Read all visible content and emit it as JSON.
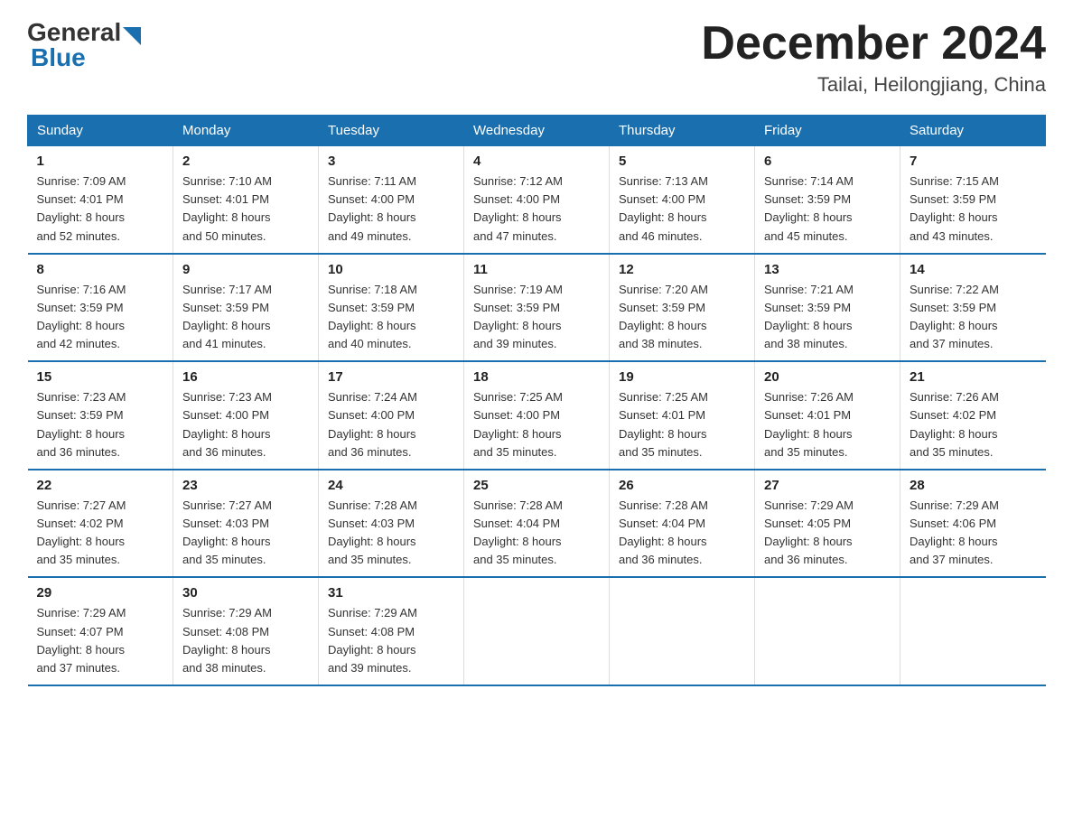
{
  "logo": {
    "general": "General",
    "blue": "Blue"
  },
  "title": {
    "month": "December 2024",
    "location": "Tailai, Heilongjiang, China"
  },
  "days_header": [
    "Sunday",
    "Monday",
    "Tuesday",
    "Wednesday",
    "Thursday",
    "Friday",
    "Saturday"
  ],
  "weeks": [
    [
      {
        "day": "1",
        "sunrise": "7:09 AM",
        "sunset": "4:01 PM",
        "daylight": "8 hours and 52 minutes."
      },
      {
        "day": "2",
        "sunrise": "7:10 AM",
        "sunset": "4:01 PM",
        "daylight": "8 hours and 50 minutes."
      },
      {
        "day": "3",
        "sunrise": "7:11 AM",
        "sunset": "4:00 PM",
        "daylight": "8 hours and 49 minutes."
      },
      {
        "day": "4",
        "sunrise": "7:12 AM",
        "sunset": "4:00 PM",
        "daylight": "8 hours and 47 minutes."
      },
      {
        "day": "5",
        "sunrise": "7:13 AM",
        "sunset": "4:00 PM",
        "daylight": "8 hours and 46 minutes."
      },
      {
        "day": "6",
        "sunrise": "7:14 AM",
        "sunset": "3:59 PM",
        "daylight": "8 hours and 45 minutes."
      },
      {
        "day": "7",
        "sunrise": "7:15 AM",
        "sunset": "3:59 PM",
        "daylight": "8 hours and 43 minutes."
      }
    ],
    [
      {
        "day": "8",
        "sunrise": "7:16 AM",
        "sunset": "3:59 PM",
        "daylight": "8 hours and 42 minutes."
      },
      {
        "day": "9",
        "sunrise": "7:17 AM",
        "sunset": "3:59 PM",
        "daylight": "8 hours and 41 minutes."
      },
      {
        "day": "10",
        "sunrise": "7:18 AM",
        "sunset": "3:59 PM",
        "daylight": "8 hours and 40 minutes."
      },
      {
        "day": "11",
        "sunrise": "7:19 AM",
        "sunset": "3:59 PM",
        "daylight": "8 hours and 39 minutes."
      },
      {
        "day": "12",
        "sunrise": "7:20 AM",
        "sunset": "3:59 PM",
        "daylight": "8 hours and 38 minutes."
      },
      {
        "day": "13",
        "sunrise": "7:21 AM",
        "sunset": "3:59 PM",
        "daylight": "8 hours and 38 minutes."
      },
      {
        "day": "14",
        "sunrise": "7:22 AM",
        "sunset": "3:59 PM",
        "daylight": "8 hours and 37 minutes."
      }
    ],
    [
      {
        "day": "15",
        "sunrise": "7:23 AM",
        "sunset": "3:59 PM",
        "daylight": "8 hours and 36 minutes."
      },
      {
        "day": "16",
        "sunrise": "7:23 AM",
        "sunset": "4:00 PM",
        "daylight": "8 hours and 36 minutes."
      },
      {
        "day": "17",
        "sunrise": "7:24 AM",
        "sunset": "4:00 PM",
        "daylight": "8 hours and 36 minutes."
      },
      {
        "day": "18",
        "sunrise": "7:25 AM",
        "sunset": "4:00 PM",
        "daylight": "8 hours and 35 minutes."
      },
      {
        "day": "19",
        "sunrise": "7:25 AM",
        "sunset": "4:01 PM",
        "daylight": "8 hours and 35 minutes."
      },
      {
        "day": "20",
        "sunrise": "7:26 AM",
        "sunset": "4:01 PM",
        "daylight": "8 hours and 35 minutes."
      },
      {
        "day": "21",
        "sunrise": "7:26 AM",
        "sunset": "4:02 PM",
        "daylight": "8 hours and 35 minutes."
      }
    ],
    [
      {
        "day": "22",
        "sunrise": "7:27 AM",
        "sunset": "4:02 PM",
        "daylight": "8 hours and 35 minutes."
      },
      {
        "day": "23",
        "sunrise": "7:27 AM",
        "sunset": "4:03 PM",
        "daylight": "8 hours and 35 minutes."
      },
      {
        "day": "24",
        "sunrise": "7:28 AM",
        "sunset": "4:03 PM",
        "daylight": "8 hours and 35 minutes."
      },
      {
        "day": "25",
        "sunrise": "7:28 AM",
        "sunset": "4:04 PM",
        "daylight": "8 hours and 35 minutes."
      },
      {
        "day": "26",
        "sunrise": "7:28 AM",
        "sunset": "4:04 PM",
        "daylight": "8 hours and 36 minutes."
      },
      {
        "day": "27",
        "sunrise": "7:29 AM",
        "sunset": "4:05 PM",
        "daylight": "8 hours and 36 minutes."
      },
      {
        "day": "28",
        "sunrise": "7:29 AM",
        "sunset": "4:06 PM",
        "daylight": "8 hours and 37 minutes."
      }
    ],
    [
      {
        "day": "29",
        "sunrise": "7:29 AM",
        "sunset": "4:07 PM",
        "daylight": "8 hours and 37 minutes."
      },
      {
        "day": "30",
        "sunrise": "7:29 AM",
        "sunset": "4:08 PM",
        "daylight": "8 hours and 38 minutes."
      },
      {
        "day": "31",
        "sunrise": "7:29 AM",
        "sunset": "4:08 PM",
        "daylight": "8 hours and 39 minutes."
      },
      null,
      null,
      null,
      null
    ]
  ],
  "labels": {
    "sunrise": "Sunrise:",
    "sunset": "Sunset:",
    "daylight": "Daylight:"
  }
}
